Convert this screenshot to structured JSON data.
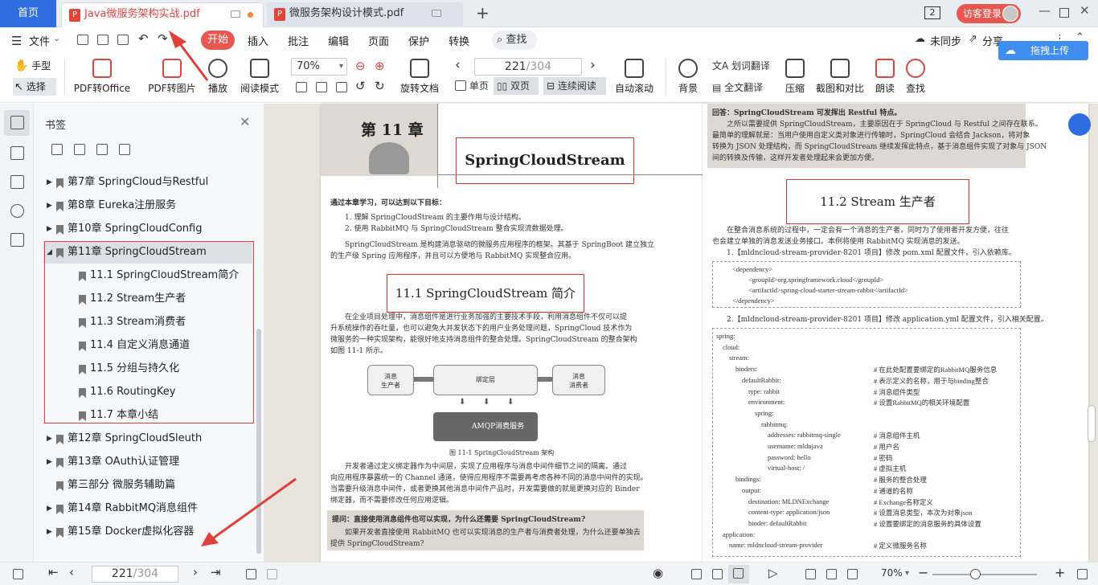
{
  "titlebar": {
    "home": "首页",
    "tabs": [
      {
        "label": "Java微服务架构实战.pdf",
        "active": true
      },
      {
        "label": "微服务架构设计模式.pdf",
        "active": false
      }
    ],
    "new_tab": "+",
    "page_count_badge": "2",
    "login": "访客登录"
  },
  "menu": {
    "file": "文件",
    "items": [
      "开始",
      "插入",
      "批注",
      "编辑",
      "页面",
      "保护",
      "转换"
    ],
    "search": "查找",
    "sync": "未同步",
    "share": "分享"
  },
  "toolbar": {
    "hand": "手型",
    "select": "选择",
    "pdf_office": "PDF转Office",
    "pdf_image": "PDF转图片",
    "play": "播放",
    "read_mode": "阅读模式",
    "zoom": "70%",
    "rotate": "旋转文档",
    "page_current": "221",
    "page_total": "/304",
    "single": "单页",
    "double": "双页",
    "continuous": "连续阅读",
    "auto_scroll": "自动滚动",
    "background": "背景",
    "word_translate": "划词翻译",
    "full_translate": "全文翻译",
    "compress": "压缩",
    "crop_compare": "截图和对比",
    "read_aloud": "朗读",
    "find": "查找",
    "upload": "拖拽上传"
  },
  "bookmarks": {
    "title": "书签",
    "items": [
      {
        "label": "第7章 SpringCloud与Restful",
        "level": 0,
        "expand": "▶"
      },
      {
        "label": "第8章 Eureka注册服务",
        "level": 0,
        "expand": "▶"
      },
      {
        "label": "第10章 SpringCloudConfig",
        "level": 0,
        "expand": "▶"
      },
      {
        "label": "第11章 SpringCloudStream",
        "level": 0,
        "expand": "◢"
      },
      {
        "label": "11.1 SpringCloudStream简介",
        "level": 1
      },
      {
        "label": "11.2 Stream生产者",
        "level": 1
      },
      {
        "label": "11.3 Stream消费者",
        "level": 1
      },
      {
        "label": "11.4 自定义消息通道",
        "level": 1
      },
      {
        "label": "11.5 分组与持久化",
        "level": 1
      },
      {
        "label": "11.6 RoutingKey",
        "level": 1
      },
      {
        "label": "11.7 本章小结",
        "level": 1
      },
      {
        "label": "第12章 SpringCloudSleuth",
        "level": 0,
        "expand": "▶"
      },
      {
        "label": "第13章 OAuth认证管理",
        "level": 0,
        "expand": "▶"
      },
      {
        "label": "第三部分 微服务辅助篇",
        "level": 0,
        "expand": ""
      },
      {
        "label": "第14章 RabbitMQ消息组件",
        "level": 0,
        "expand": "▶"
      },
      {
        "label": "第15章 Docker虚拟化容器",
        "level": 0,
        "expand": "▶"
      }
    ]
  },
  "left_page": {
    "chapter": "第 11 章",
    "chapter_title": "SpringCloudStream",
    "goals_head": "通过本章学习，可以达到以下目标：",
    "goal1": "1. 理解 SpringCloudStream 的主要作用与设计结构。",
    "goal2": "2. 使用 RabbitMQ 与 SpringCloudStream 整合实现流数据处理。",
    "intro1": "SpringCloudStream 是构建消息驱动的微服务应用程序的框架。其基于 SpringBoot 建立独立",
    "intro2": "的生产级 Spring 应用程序，并且可以方便地与 RabbitMQ 实现整合应用。",
    "section": "11.1   SpringCloudStream 简介",
    "p1": "在企业项目处理中，消息组件是进行业务加强的主要技术手段，利用消息组件不仅可以提",
    "p2": "升系统操作的吞吐量，也可以避免大并发状态下的用户业务处理问题，SpringCloud 技术作为",
    "p3": "微服务的一种实现架构，能很好地支持消息组件的整合处理。SpringCloudStream 的整合架构",
    "p4": "如图 11-1 所示。",
    "producer": "消息\n生产者",
    "binder": "绑定层",
    "consumer": "消息\n消费者",
    "amqp": "AMQP消费服务",
    "fig_caption": "图 11-1    SpringCloudStream 架构",
    "q1": "开发者通过定义绑定器作为中间层，实现了应用程序与消息中间件细节之间的隔离。通过",
    "q2": "向应用程序暴露统一的 Channel 通道，使得应用程序不需要再考虑各种不同的消息中间件的实现。",
    "q3": "当需要升级消息中间件，或者更换其他消息中间件产品时，开发需要做的就是更换对应的 Binder",
    "q4": "绑定器，而不需要修改任何应用逻辑。",
    "ask": "提问：直接使用消息组件也可以实现，为什么还需要 SpringCloudStream?",
    "ask1": "如果开发者直接使用 RabbitMQ 也可以实现消息的生产者与消费者处理，为什么还要单独去",
    "ask2": "提供 SpringCloudStream?"
  },
  "right_page": {
    "ans_head": "回答：SpringCloudStream 可发挥出 Restful 特点。",
    "ans1": "之所以需要提供 SpringCloudStream，主要原因在于 SpringCloud 与 Restful 之间存在联系。",
    "ans2": "最简单的理解就是：当用户使用自定义类对象进行传输时，SpringCloud 会结合 Jackson，将对象",
    "ans3": "转换为 JSON 处理结构，而 SpringCloudStream 继续发挥此特点，基于消息组件实现了对象与 JSON",
    "ans4": "间的转换及传输，这样开发者处理起来会更加方便。",
    "section": "11.2    Stream 生产者",
    "p1": "在整合消息系统的过程中，一定会有一个消息的生产者，同时为了使用者开发方便，往往",
    "p2": "也会建立单独的消息发送业务接口。本例将使用 RabbitMQ 实现消息的发送。",
    "step1": "1.【mldncloud-stream-provider-8201 项目】修改 pom.xml 配置文件，引入依赖库。",
    "pom": [
      "<dependency>",
      "<groupId>org.springframework.cloud</groupId>",
      "<artifactId>spring-cloud-starter-stream-rabbit</artifactId>",
      "</dependency>"
    ],
    "step2": "2.【mldncloud-stream-provider-8201 项目】修改 application.yml 配置文件，引入相关配置。",
    "yml": [
      {
        "code": "spring:",
        "indent": 0,
        "comment": ""
      },
      {
        "code": "cloud:",
        "indent": 1,
        "comment": ""
      },
      {
        "code": "stream:",
        "indent": 2,
        "comment": ""
      },
      {
        "code": "binders:",
        "indent": 3,
        "comment": "# 在此处配置要绑定的RabbitMQ服务信息"
      },
      {
        "code": "defaultRabbit:",
        "indent": 4,
        "comment": "# 表示定义的名称，用于与binding整合"
      },
      {
        "code": "type: rabbit",
        "indent": 5,
        "comment": "# 消息组件类型"
      },
      {
        "code": "environment:",
        "indent": 5,
        "comment": "# 设置RabbitMQ的相关环境配置"
      },
      {
        "code": "spring:",
        "indent": 6,
        "comment": ""
      },
      {
        "code": "rabbitmq:",
        "indent": 7,
        "comment": ""
      },
      {
        "code": "addresses: rabbitmq-single",
        "indent": 8,
        "comment": "# 消息组件主机"
      },
      {
        "code": "username: mldnjava",
        "indent": 8,
        "comment": "# 用户名"
      },
      {
        "code": "password: hello",
        "indent": 8,
        "comment": "# 密码"
      },
      {
        "code": "virtual-host: /",
        "indent": 8,
        "comment": "# 虚拟主机"
      },
      {
        "code": "bindings:",
        "indent": 3,
        "comment": "# 服务的整合处理"
      },
      {
        "code": "output:",
        "indent": 4,
        "comment": "# 通道的名称"
      },
      {
        "code": "destination: MLDNExchange",
        "indent": 5,
        "comment": "# Exchange名称定义"
      },
      {
        "code": "content-type: application/json",
        "indent": 5,
        "comment": "# 设置消息类型，本次为对象json"
      },
      {
        "code": "binder: defaultRabbit",
        "indent": 5,
        "comment": "# 设置要绑定的消息服务的具体设置"
      },
      {
        "code": "application:",
        "indent": 1,
        "comment": ""
      },
      {
        "code": "name: mldncloud-stream-provider",
        "indent": 2,
        "comment": "# 定义微服务名称"
      }
    ]
  },
  "statusbar": {
    "page_current": "221",
    "page_total": "/304",
    "zoom": "70%",
    "zoom_minus": "−",
    "zoom_plus": "+"
  },
  "colors": {
    "accent": "#2f6ee0",
    "brand_red": "#e5574f",
    "annotation_red": "#e0403b"
  }
}
